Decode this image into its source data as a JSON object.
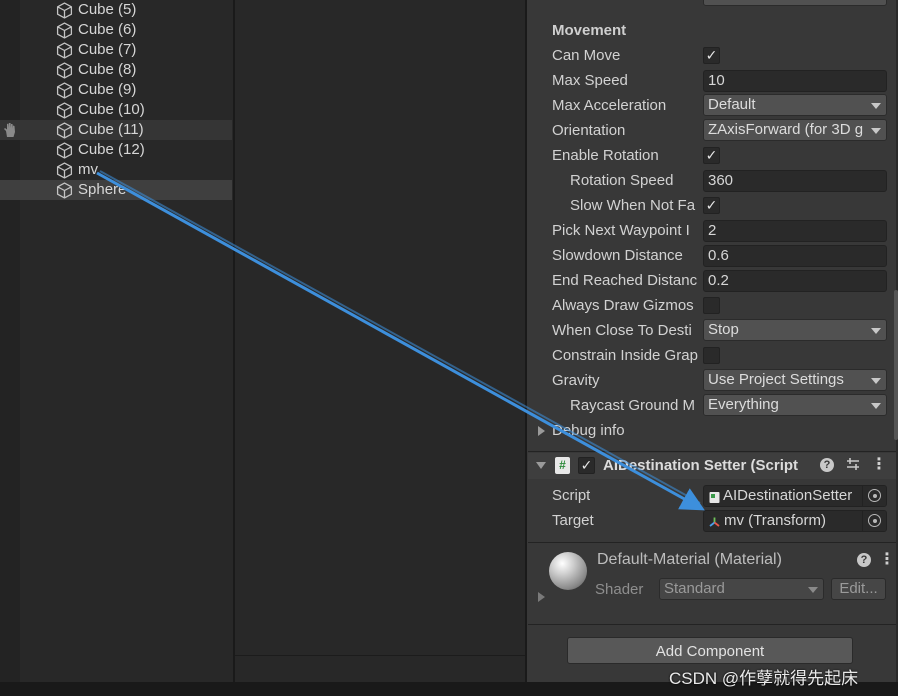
{
  "hierarchy": {
    "items": [
      {
        "label": "Cube (5)"
      },
      {
        "label": "Cube (6)"
      },
      {
        "label": "Cube (7)"
      },
      {
        "label": "Cube (8)"
      },
      {
        "label": "Cube (9)"
      },
      {
        "label": "Cube (10)"
      },
      {
        "label": "Cube (11)"
      },
      {
        "label": "Cube (12)"
      },
      {
        "label": "mv"
      },
      {
        "label": "Sphere"
      }
    ]
  },
  "inspector": {
    "section_title": "Movement",
    "can_move": {
      "label": "Can Move",
      "checked": "✓"
    },
    "max_speed": {
      "label": "Max Speed",
      "value": "10"
    },
    "max_acceleration": {
      "label": "Max Acceleration",
      "value": "Default"
    },
    "orientation": {
      "label": "Orientation",
      "value": "ZAxisForward (for 3D g"
    },
    "enable_rotation": {
      "label": "Enable Rotation",
      "checked": "✓"
    },
    "rotation_speed": {
      "label": "Rotation Speed",
      "value": "360"
    },
    "slow_when_not_facing": {
      "label": "Slow When Not Fa",
      "checked": "✓"
    },
    "pick_next_waypoint": {
      "label": "Pick Next Waypoint I",
      "value": "2"
    },
    "slowdown_distance": {
      "label": "Slowdown Distance",
      "value": "0.6"
    },
    "end_reached_distance": {
      "label": "End Reached Distanc",
      "value": "0.2"
    },
    "always_draw_gizmos": {
      "label": "Always Draw Gizmos",
      "checked": ""
    },
    "when_close_to_destination": {
      "label": "When Close To Desti",
      "value": "Stop"
    },
    "constrain_inside_graph": {
      "label": "Constrain Inside Grap",
      "checked": ""
    },
    "gravity": {
      "label": "Gravity",
      "value": "Use Project Settings"
    },
    "raycast_ground_mask": {
      "label": "Raycast Ground M",
      "value": "Everything"
    },
    "debug_info": {
      "label": "Debug info"
    },
    "component": {
      "title": "AIDestination Setter (Script",
      "enabled": "✓",
      "help_icon": "?",
      "menu_icon": "⋮",
      "script": {
        "label": "Script",
        "value": "AIDestinationSetter"
      },
      "target": {
        "label": "Target",
        "value": "mv (Transform)"
      }
    },
    "material": {
      "name": "Default-Material (Material)",
      "shader_label": "Shader",
      "shader_value": "Standard",
      "edit_label": "Edit...",
      "help_icon": "?",
      "menu_icon": "⋮"
    },
    "add_component_label": "Add Component"
  },
  "watermark": "CSDN @作孽就得先起床",
  "colors": {
    "arrow": "#3d8fdc",
    "panel": "#383838",
    "hierarchy_bg": "#282828"
  }
}
